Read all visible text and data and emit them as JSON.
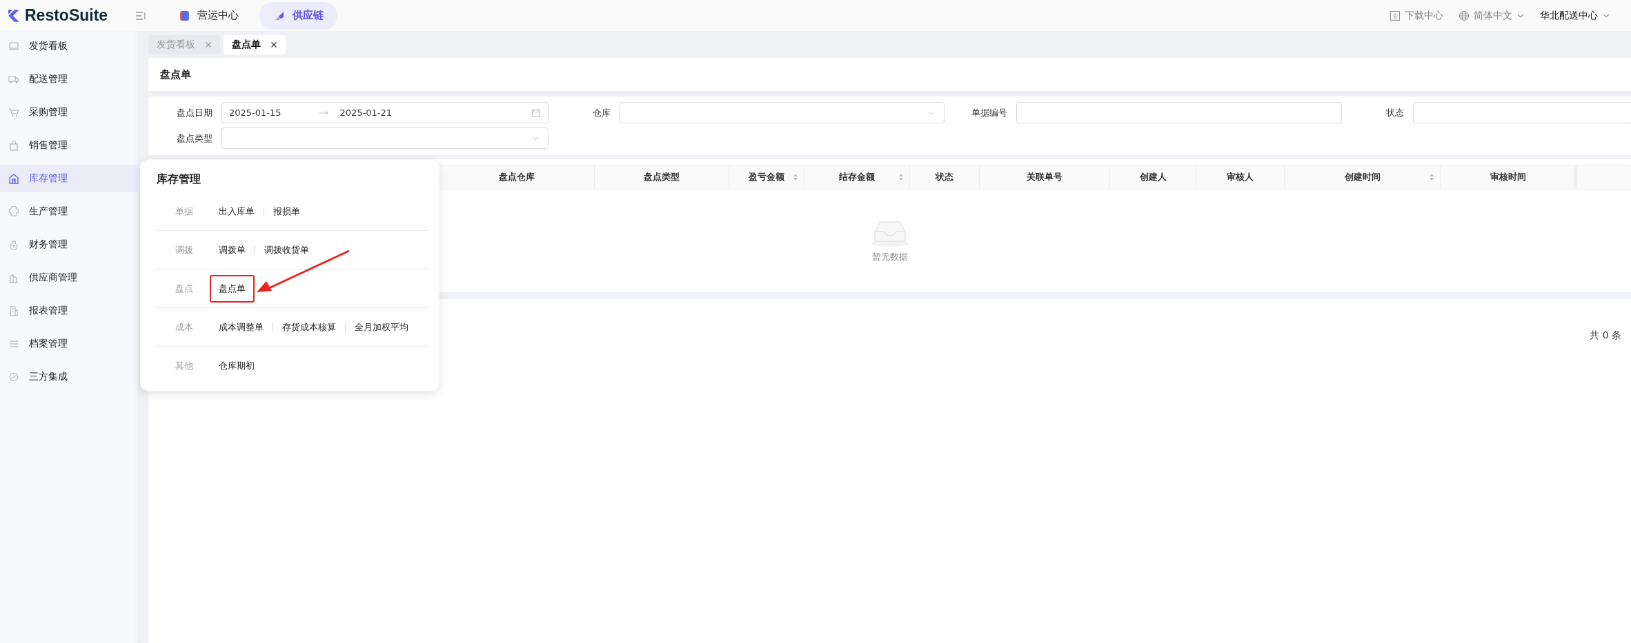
{
  "header": {
    "logo": "RestoSuite",
    "nav": [
      {
        "label": "营运中心",
        "selected": false
      },
      {
        "label": "供应链",
        "selected": true
      }
    ],
    "actions": [
      {
        "kind": "download",
        "label": "下载中心"
      },
      {
        "kind": "language",
        "label": "简体中文"
      },
      {
        "kind": "store",
        "label": "华北配送中心"
      }
    ]
  },
  "sidebar": {
    "items": [
      {
        "label": "发货看板",
        "selected": false
      },
      {
        "label": "配送管理",
        "selected": false
      },
      {
        "label": "采购管理",
        "selected": false
      },
      {
        "label": "销售管理",
        "selected": false
      },
      {
        "label": "库存管理",
        "selected": true
      },
      {
        "label": "生产管理",
        "selected": false
      },
      {
        "label": "财务管理",
        "selected": false
      },
      {
        "label": "供应商管理",
        "selected": false
      },
      {
        "label": "报表管理",
        "selected": false
      },
      {
        "label": "档案管理",
        "selected": false
      },
      {
        "label": "三方集成",
        "selected": false
      }
    ]
  },
  "page_tabs": [
    {
      "label": "发货看板",
      "selected": false
    },
    {
      "label": "盘点单",
      "selected": true
    }
  ],
  "page_title": "盘点单",
  "filters": [
    {
      "kind": "daterange",
      "label": "盘点日期",
      "start": "2025-01-15",
      "end": "2025-01-21"
    },
    {
      "kind": "select",
      "label": "仓库"
    },
    {
      "kind": "input",
      "label": "单据编号"
    },
    {
      "kind": "input",
      "label": "状态"
    },
    {
      "kind": "select",
      "label": "盘点类型"
    }
  ],
  "table": {
    "columns": [
      {
        "label": "盘点仓库",
        "sortable": false
      },
      {
        "label": "盘点类型",
        "sortable": false
      },
      {
        "label": "盈亏金额",
        "sortable": true
      },
      {
        "label": "结存金额",
        "sortable": true
      },
      {
        "label": "状态",
        "sortable": false
      },
      {
        "label": "关联单号",
        "sortable": false
      },
      {
        "label": "创建人",
        "sortable": false
      },
      {
        "label": "审核人",
        "sortable": false
      },
      {
        "label": "创建时间",
        "sortable": true
      },
      {
        "label": "审核时间",
        "sortable": false
      }
    ],
    "empty_text": "暂无数据"
  },
  "pagination": {
    "total": "共 0 条"
  },
  "popup": {
    "title": "库存管理",
    "groups": [
      {
        "label": "单据",
        "links": [
          {
            "label": "出入库单",
            "highlighted": false
          },
          {
            "label": "报损单",
            "highlighted": false
          }
        ]
      },
      {
        "label": "调拨",
        "links": [
          {
            "label": "调拨单",
            "highlighted": false
          },
          {
            "label": "调拨收货单",
            "highlighted": false
          }
        ]
      },
      {
        "label": "盘点",
        "links": [
          {
            "label": "盘点单",
            "highlighted": true
          }
        ]
      },
      {
        "label": "成本",
        "links": [
          {
            "label": "成本调整单",
            "highlighted": false
          },
          {
            "label": "存货成本核算",
            "highlighted": false
          },
          {
            "label": "全月加权平均",
            "highlighted": false
          }
        ]
      },
      {
        "label": "其他",
        "links": [
          {
            "label": "仓库期初",
            "highlighted": false
          }
        ]
      }
    ]
  }
}
